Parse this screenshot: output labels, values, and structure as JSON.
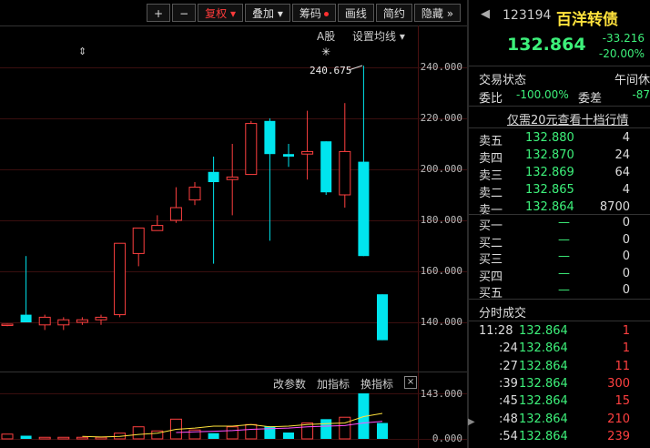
{
  "toolbar": {
    "plus": "+",
    "minus": "−",
    "fuquan": "复权",
    "diejia": "叠加",
    "chouma": "筹码",
    "huaxian": "画线",
    "jianyue": "简约",
    "yincang": "隐藏",
    "more": "»"
  },
  "chart_header": {
    "a_share": "A股",
    "set_ma": "设置均线"
  },
  "price_axis": [
    "240.000",
    "220.000",
    "200.000",
    "180.000",
    "160.000",
    "140.000"
  ],
  "annot": {
    "high": "240.675"
  },
  "vol_axis": [
    "143.000",
    "0.000"
  ],
  "sub_toolbar": {
    "params": "改参数",
    "add": "加指标",
    "switch": "换指标",
    "close": "×"
  },
  "colors": {
    "up": "#ff4040",
    "down": "#00e5ee",
    "ma1": "#ffe23c",
    "ma2": "#ff50ff"
  },
  "chart_data": {
    "type": "candlestick",
    "ohlc": [
      [
        139,
        139.5,
        138.5,
        139.3
      ],
      [
        143,
        166,
        140,
        140
      ],
      [
        139,
        143,
        137,
        142
      ],
      [
        139,
        142,
        137,
        141
      ],
      [
        140,
        142,
        139,
        141
      ],
      [
        141,
        143,
        139,
        142
      ],
      [
        143,
        171,
        142,
        171
      ],
      [
        167,
        177,
        162,
        177
      ],
      [
        176,
        182,
        176,
        178
      ],
      [
        180,
        193,
        179,
        185
      ],
      [
        188,
        195,
        186,
        193
      ],
      [
        199,
        205,
        163,
        195
      ],
      [
        196,
        210,
        182,
        197
      ],
      [
        198,
        219,
        198,
        218
      ],
      [
        219,
        220,
        172,
        206
      ],
      [
        206,
        210,
        201,
        205
      ],
      [
        206,
        223,
        196,
        207
      ],
      [
        211,
        211,
        190,
        191
      ],
      [
        190,
        226,
        185,
        207
      ],
      [
        203,
        240.675,
        166,
        166
      ],
      [
        151,
        151,
        133,
        133
      ]
    ],
    "volume": [
      15,
      10,
      5,
      5,
      5,
      5,
      18,
      38,
      25,
      62,
      28,
      18,
      38,
      45,
      40,
      20,
      50,
      62,
      68,
      143,
      50
    ],
    "ma_vol_1": [
      null,
      null,
      null,
      null,
      8,
      6,
      8,
      14,
      18,
      30,
      34,
      40,
      40,
      45,
      38,
      40,
      45,
      48,
      50,
      70,
      80
    ],
    "ma_vol_2": [
      null,
      null,
      null,
      null,
      null,
      null,
      null,
      null,
      null,
      20,
      22,
      24,
      26,
      30,
      32,
      34,
      38,
      40,
      42,
      50,
      55
    ]
  },
  "quote": {
    "code": "123194",
    "name": "百洋转债",
    "price": "132.864",
    "change": "-33.216",
    "pct": "-20.00%",
    "status_label": "交易状态",
    "status_value": "午间休",
    "weibi_label": "委比",
    "weibi_value": "-100.00%",
    "weicha_label": "委差",
    "weicha_value": "-87",
    "promo": "仅需20元查看十档行情"
  },
  "asks": [
    {
      "label": "卖五",
      "price": "132.880",
      "vol": "4"
    },
    {
      "label": "卖四",
      "price": "132.870",
      "vol": "24"
    },
    {
      "label": "卖三",
      "price": "132.869",
      "vol": "64"
    },
    {
      "label": "卖二",
      "price": "132.865",
      "vol": "4"
    },
    {
      "label": "卖一",
      "price": "132.864",
      "vol": "8700"
    }
  ],
  "bids": [
    {
      "label": "买一",
      "price": "—",
      "vol": "0"
    },
    {
      "label": "买二",
      "price": "—",
      "vol": "0"
    },
    {
      "label": "买三",
      "price": "—",
      "vol": "0"
    },
    {
      "label": "买四",
      "price": "—",
      "vol": "0"
    },
    {
      "label": "买五",
      "price": "—",
      "vol": "0"
    }
  ],
  "ticks_title": "分时成交",
  "ticks": [
    {
      "t": "11:28",
      "p": "132.864",
      "v": "1"
    },
    {
      "t": ":24",
      "p": "132.864",
      "v": "1"
    },
    {
      "t": ":27",
      "p": "132.864",
      "v": "11"
    },
    {
      "t": ":39",
      "p": "132.864",
      "v": "300"
    },
    {
      "t": ":45",
      "p": "132.864",
      "v": "15"
    },
    {
      "t": ":48",
      "p": "132.864",
      "v": "210"
    },
    {
      "t": ":54",
      "p": "132.864",
      "v": "239"
    }
  ]
}
